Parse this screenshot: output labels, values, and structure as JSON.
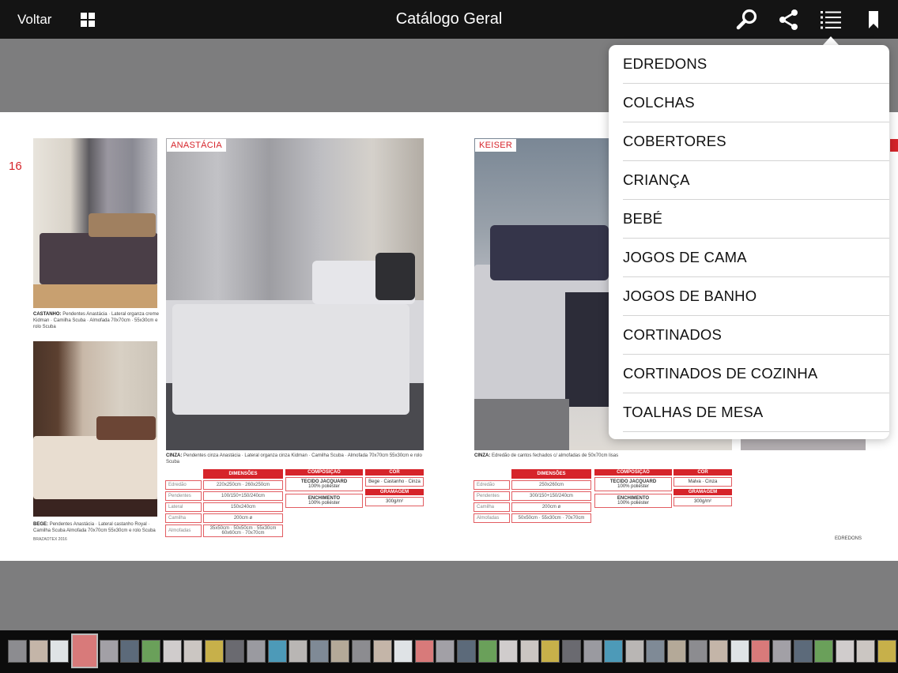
{
  "topbar": {
    "back_label": "Voltar",
    "title": "Catálogo Geral",
    "icons": [
      "grid-icon",
      "search-icon",
      "share-icon",
      "list-icon",
      "bookmark-icon"
    ]
  },
  "spread": {
    "page_number": "16",
    "left_product": {
      "name": "ANASTÁCIA",
      "caption_castanho_label": "CASTANHO:",
      "caption_castanho": "Pendentes Anastácia · Lateral organza creme Kidman · Camilha Scuba · Almofada 70x70cm · 55x30cm e rolo Scuba",
      "caption_bege_label": "BEGE:",
      "caption_bege": "Pendentes Anastácia · Lateral castanho Royal · Camilha Scuba Almofada 70x70cm 55x30cm e rolo Scuba",
      "caption_cinza_label": "CINZA:",
      "caption_cinza": "Pendentes cinza Anastácia · Lateral organza cinza Kidman · Camilha Scuba · Almofada 70x70cm 55x30cm e rolo Scuba",
      "table_header": "DIMENSÕES",
      "rows": [
        {
          "label": "Edredão",
          "value": "220x250cm · 260x250cm"
        },
        {
          "label": "Pendentes",
          "value": "100/150+150/240cm"
        },
        {
          "label": "Lateral",
          "value": "150x240cm"
        },
        {
          "label": "Camilha",
          "value": "200cm ø"
        },
        {
          "label": "Almofadas",
          "value": "35x50cm · 50x50cm · 55x30cm 60x60cm · 70x70cm"
        }
      ],
      "composition_header": "COMPOSIÇÃO",
      "composition_1_title": "TECIDO JACQUARD",
      "composition_1_text": "100% poliéster",
      "composition_2_title": "ENCHIMENTO",
      "composition_2_text": "100% poliéster",
      "color_header": "COR",
      "color_value": "Bege · Castanho · Cinza",
      "weight_header": "GRAMAGEM",
      "weight_value": "300g/m²",
      "footer": "BRAZAOTEX 2016"
    },
    "right_product": {
      "name": "KEISER",
      "caption_cinza_label": "CINZA:",
      "caption_cinza": "Edredão de cantos fechados c/ almofadas de 50x70cm lisas",
      "table_header": "DIMENSÕES",
      "rows": [
        {
          "label": "Edredão",
          "value": "250x260cm"
        },
        {
          "label": "Pendentes",
          "value": "300/150+150/240cm"
        },
        {
          "label": "Camilha",
          "value": "200cm ø"
        },
        {
          "label": "Almofadas",
          "value": "50x50cm · 55x30cm · 70x70cm"
        }
      ],
      "composition_header": "COMPOSIÇÃO",
      "composition_1_title": "TECIDO JACQUARD",
      "composition_1_text": "100% poliéster",
      "composition_2_title": "ENCHIMENTO",
      "composition_2_text": "100% poliéster",
      "color_header": "COR",
      "color_value": "Malva · Cinza",
      "weight_header": "GRAMAGEM",
      "weight_value": "300g/m²",
      "footer": "EDREDONS"
    }
  },
  "menu": {
    "items": [
      {
        "label": "EDREDONS"
      },
      {
        "label": "COLCHAS"
      },
      {
        "label": "COBERTORES"
      },
      {
        "label": "CRIANÇA"
      },
      {
        "label": "BEBÉ"
      },
      {
        "label": "JOGOS DE CAMA"
      },
      {
        "label": "JOGOS DE BANHO"
      },
      {
        "label": "CORTINADOS"
      },
      {
        "label": "CORTINADOS DE COZINHA"
      },
      {
        "label": "TOALHAS DE MESA"
      }
    ]
  },
  "colors": {
    "topbar": "#141414",
    "accent_red": "#d6242a",
    "background": "#7d7d7e"
  }
}
